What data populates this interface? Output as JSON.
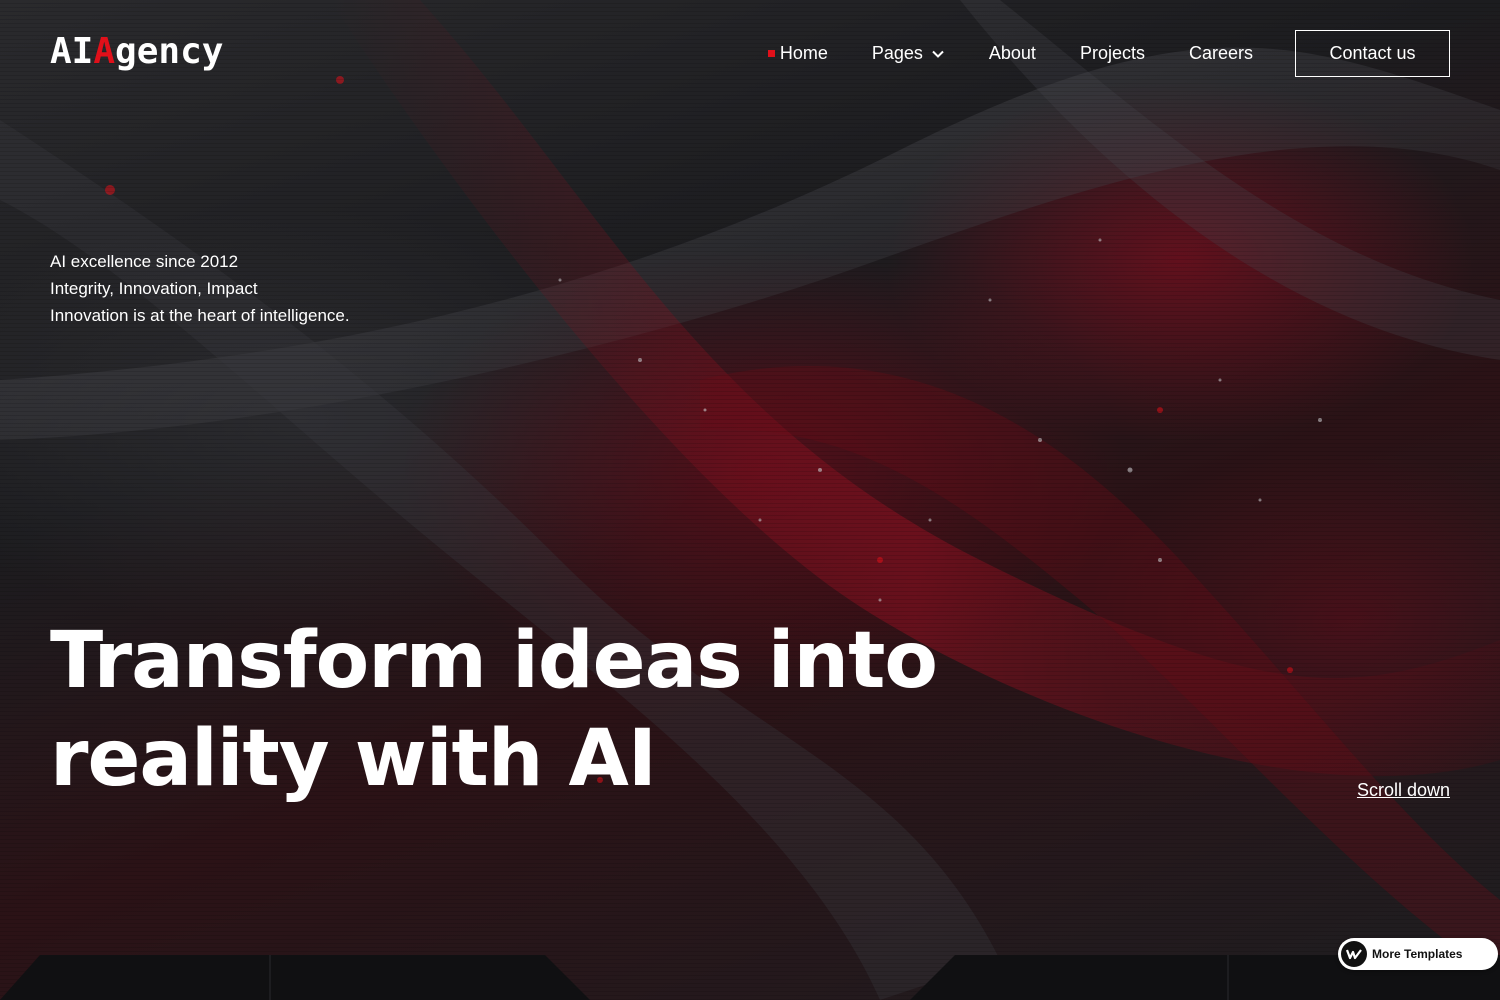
{
  "logo": {
    "part1": "AI",
    "part2": "A",
    "part3": "gency"
  },
  "nav": {
    "items": [
      {
        "label": "Home",
        "active": true
      },
      {
        "label": "Pages",
        "dropdown": true
      },
      {
        "label": "About"
      },
      {
        "label": "Projects"
      },
      {
        "label": "Careers"
      }
    ],
    "contact_label": "Contact us"
  },
  "tagline": {
    "line1": "AI excellence since 2012",
    "line2": "Integrity, Innovation, Impact",
    "line3": "Innovation is at the heart of intelligence."
  },
  "headline": {
    "line1": "Transform ideas into",
    "line2": "reality with AI"
  },
  "scroll_label": "Scroll down",
  "badge": {
    "label": "More Templates"
  },
  "colors": {
    "accent": "#e0101a",
    "background": "#1b1b1d",
    "text": "#ffffff"
  },
  "icons": {
    "dropdown": "chevron-down-icon",
    "badge": "webflow-logo-icon"
  }
}
